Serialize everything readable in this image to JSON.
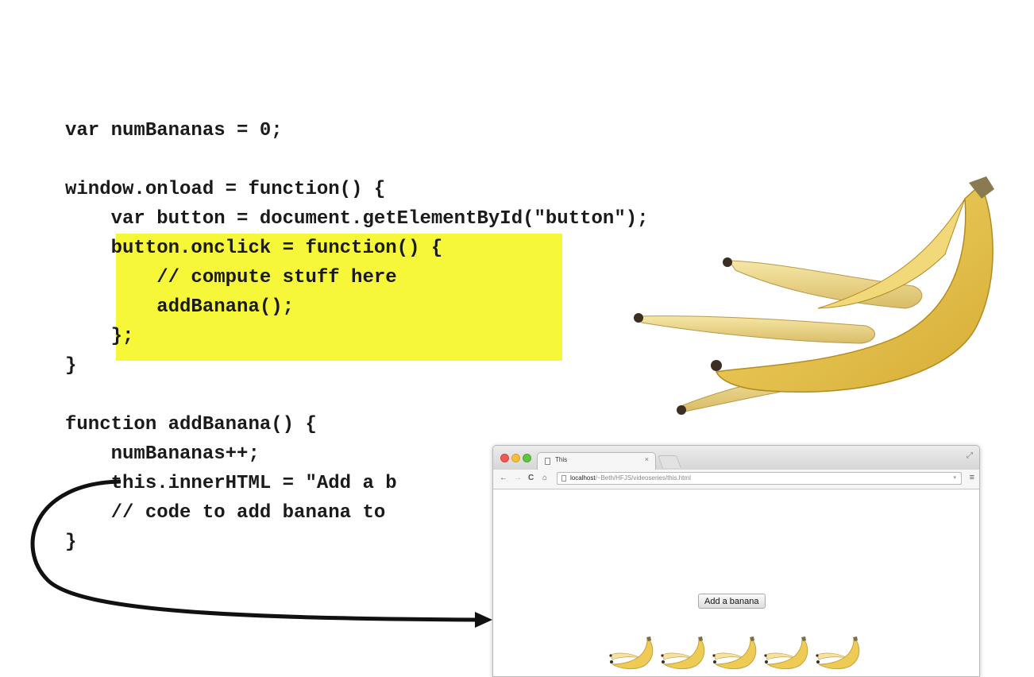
{
  "code": {
    "lines": [
      "var numBananas = 0;",
      "",
      "window.onload = function() {",
      "    var button = document.getElementById(\"button\");",
      "    button.onclick = function() {",
      "        // compute stuff here",
      "        addBanana();",
      "    };",
      "}",
      "",
      "function addBanana() {",
      "    numBananas++;",
      "    this.innerHTML = \"Add a b",
      "    // code to add banana to",
      "}"
    ]
  },
  "browser": {
    "tab_title": "This",
    "tab_close": "×",
    "url_host": "localhost",
    "url_path": "/~Beth/HFJS/videoseries/this.html",
    "nav": {
      "back": "←",
      "forward": "→",
      "reload": "C",
      "home": "⌂"
    },
    "menu_icon": "≡",
    "fullscreen_icon": "⤢",
    "omnibox_dropdown": "▾",
    "page_button_label": "Add a banana",
    "banana_count": 5
  },
  "colors": {
    "highlight": "#f7f73a",
    "banana_yellow": "#eecb55",
    "banana_dark": "#c9a23a"
  },
  "icons": [
    "banana-peel-image",
    "arrow-icon",
    "page-icon",
    "close-icon",
    "menu-icon",
    "reload-icon",
    "home-icon",
    "back-icon",
    "forward-icon",
    "banana-icon"
  ]
}
